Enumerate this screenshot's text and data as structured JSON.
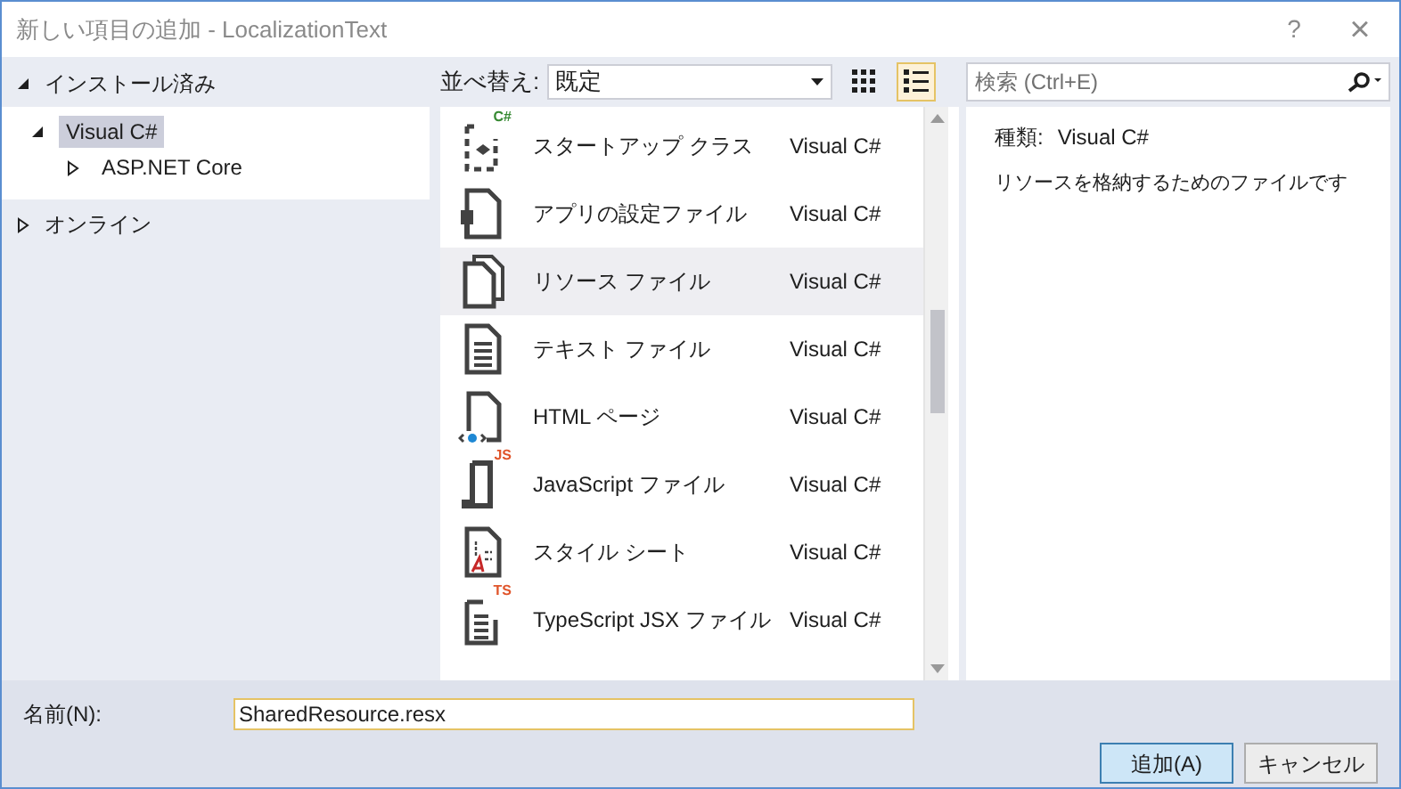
{
  "window": {
    "title": "新しい項目の追加 - LocalizationText",
    "help": "?",
    "close": "×"
  },
  "left": {
    "installed": {
      "label": "インストール済み",
      "expanded": true
    },
    "tree": [
      {
        "label": "Visual C#",
        "expanded": true,
        "selected": true,
        "children": [
          {
            "label": "ASP.NET Core",
            "expanded": false,
            "selected": false
          }
        ]
      }
    ],
    "online": {
      "label": "オンライン",
      "expanded": false
    }
  },
  "toolbar": {
    "sort_label": "並べ替え:",
    "sort_value": "既定",
    "views": [
      {
        "kind": "grid",
        "selected": false
      },
      {
        "kind": "list",
        "selected": true
      }
    ]
  },
  "items": [
    {
      "kind": "startup",
      "badge": "C#",
      "name": "スタートアップ クラス",
      "type": "Visual C#",
      "selected": false
    },
    {
      "kind": "settings",
      "name": "アプリの設定ファイル",
      "type": "Visual C#",
      "selected": false
    },
    {
      "kind": "resource",
      "name": "リソース ファイル",
      "type": "Visual C#",
      "selected": true
    },
    {
      "kind": "text",
      "name": "テキスト ファイル",
      "type": "Visual C#",
      "selected": false
    },
    {
      "kind": "html",
      "name": "HTML ページ",
      "type": "Visual C#",
      "selected": false
    },
    {
      "kind": "js",
      "badge": "JS",
      "name": "JavaScript ファイル",
      "type": "Visual C#",
      "selected": false
    },
    {
      "kind": "css",
      "name": "スタイル シート",
      "type": "Visual C#",
      "selected": false
    },
    {
      "kind": "tsx",
      "badge": "TS",
      "name": "TypeScript JSX ファイル",
      "type": "Visual C#",
      "selected": false
    }
  ],
  "search": {
    "placeholder": "検索 (Ctrl+E)"
  },
  "details": {
    "type_label": "種類:",
    "type_value": "Visual C#",
    "description": "リソースを格納するためのファイルです"
  },
  "name_field": {
    "label": "名前(N):",
    "value": "SharedResource.resx"
  },
  "buttons": [
    {
      "label": "追加(A)",
      "primary": true
    },
    {
      "label": "キャンセル",
      "primary": false
    }
  ]
}
